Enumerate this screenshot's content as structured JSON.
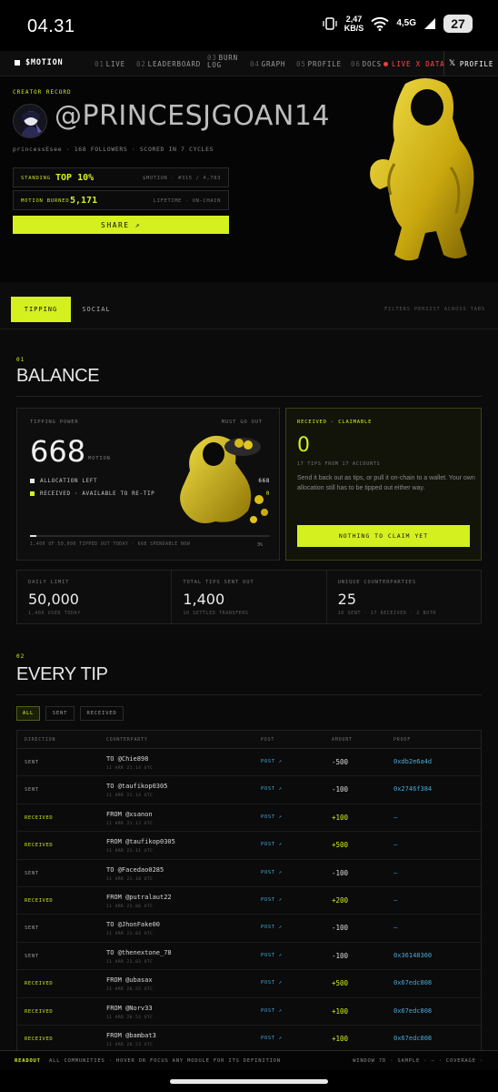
{
  "status_bar": {
    "time": "04.31",
    "net_speed_value": "2,47",
    "net_speed_unit": "KB/S",
    "network": "4,5G",
    "battery": "27"
  },
  "nav": {
    "brand": "$MOTION",
    "items": [
      {
        "num": "01",
        "label": "LIVE"
      },
      {
        "num": "02",
        "label": "LEADERBOARD"
      },
      {
        "num": "03",
        "label": "BURN LOG"
      },
      {
        "num": "04",
        "label": "GRAPH"
      },
      {
        "num": "05",
        "label": "PROFILE"
      },
      {
        "num": "06",
        "label": "DOCS"
      }
    ],
    "live_label": "LIVE X DATA",
    "profile_button": "PROFILE"
  },
  "hero": {
    "record_label": "CREATOR RECORD",
    "handle": "@PRINCESJGOAN14",
    "subline": "princessEsee · 168 FOLLOWERS · SCORED IN 7 CYCLES",
    "standing_label": "STANDING",
    "standing_value": "TOP 10%",
    "standing_right": "$MOTION · #315 / 4,783",
    "burned_label": "MOTION BURNED",
    "burned_value": "5,171",
    "burned_right": "LIFETIME · ON-CHAIN",
    "share_label": "SHARE",
    "share_arrow": "↗"
  },
  "tabs": {
    "items": [
      "TIPPING",
      "SOCIAL"
    ],
    "active": "TIPPING",
    "note": "FILTERS PERSIST ACROSS TABS"
  },
  "balance": {
    "num": "01",
    "title": "BALANCE",
    "power_label": "TIPPING POWER",
    "must_go_out": "MUST GO OUT",
    "power_value": "668",
    "power_unit": "MOTION",
    "legend": [
      {
        "label": "ALLOCATION LEFT",
        "value": "668",
        "color": "#e8e8e8"
      },
      {
        "label": "RECEIVED · AVAILABLE TO RE-TIP",
        "value": "0",
        "color": "#d4f01f"
      }
    ],
    "progress_text": "1,400 OF 50,000 TIPPED OUT TODAY · 668 SPENDABLE NOW",
    "progress_pct_label": "3%",
    "progress_fraction": 0.028,
    "claim_label": "RECEIVED · CLAIMABLE",
    "claim_value": "0",
    "claim_sub": "17 TIPS FROM 17 ACCOUNTS",
    "claim_desc": "Send it back out as tips, or pull it on-chain to a wallet. Your own allocation still has to be tipped out either way.",
    "claim_button": "NOTHING TO CLAIM YET"
  },
  "stats": [
    {
      "label": "DAILY LIMIT",
      "value": "50,000",
      "sub": "1,400 USED TODAY"
    },
    {
      "label": "TOTAL TIPS SENT OUT",
      "value": "1,400",
      "sub": "10 SETTLED TRANSFERS"
    },
    {
      "label": "UNIQUE COUNTERPARTIES",
      "value": "25",
      "sub": "10 SENT · 17 RECEIVED · 2 BOTH"
    }
  ],
  "tips": {
    "num": "02",
    "title": "EVERY TIP",
    "filters": [
      "ALL",
      "SENT",
      "RECEIVED"
    ],
    "active_filter": "ALL",
    "columns": [
      "DIRECTION",
      "COUNTERPARTY",
      "POST",
      "AMOUNT",
      "PROOF"
    ],
    "rows": [
      {
        "direction": "SENT",
        "counterparty": "TO @Chie898",
        "time": "11 ARR 21.14 UTC",
        "post": "POST ↗",
        "amount": "-500",
        "proof": "0xdb2e6a4d"
      },
      {
        "direction": "SENT",
        "counterparty": "TO @taufikop0305",
        "time": "11 ARR 21.14 UTC",
        "post": "POST ↗",
        "amount": "-100",
        "proof": "0x2746f384"
      },
      {
        "direction": "RECEIVED",
        "counterparty": "FROM @xsanon",
        "time": "11 ARR 21.12 UTC",
        "post": "POST ↗",
        "amount": "+100",
        "proof": "—"
      },
      {
        "direction": "RECEIVED",
        "counterparty": "FROM @taufikop0305",
        "time": "11 ARR 21.11 UTC",
        "post": "POST ↗",
        "amount": "+500",
        "proof": "—"
      },
      {
        "direction": "SENT",
        "counterparty": "TO @Facedao0285",
        "time": "11 ARR 21.10 UTC",
        "post": "POST ↗",
        "amount": "-100",
        "proof": "—"
      },
      {
        "direction": "RECEIVED",
        "counterparty": "FROM @putralaut22",
        "time": "11 ARR 21.06 UTC",
        "post": "POST ↗",
        "amount": "+200",
        "proof": "—"
      },
      {
        "direction": "SENT",
        "counterparty": "TO @JhonFake00",
        "time": "11 ARR 21.03 UTC",
        "post": "POST ↗",
        "amount": "-100",
        "proof": "—"
      },
      {
        "direction": "SENT",
        "counterparty": "TO @thenextone_78",
        "time": "11 ARR 21.03 UTC",
        "post": "POST ↗",
        "amount": "-100",
        "proof": "0x36148360"
      },
      {
        "direction": "RECEIVED",
        "counterparty": "FROM @ubasax",
        "time": "11 ARR 20.55 UTC",
        "post": "POST ↗",
        "amount": "+500",
        "proof": "0x67edc808"
      },
      {
        "direction": "RECEIVED",
        "counterparty": "FROM @Norv33",
        "time": "11 ARR 20.53 UTC",
        "post": "POST ↗",
        "amount": "+100",
        "proof": "0x67edc808"
      },
      {
        "direction": "RECEIVED",
        "counterparty": "FROM @bambat3",
        "time": "11 ARR 20.53 UTC",
        "post": "POST ↗",
        "amount": "+100",
        "proof": "0x67edc808"
      }
    ]
  },
  "readout": {
    "label": "READOUT",
    "text": "ALL COMMUNITIES · HOVER OR FOCUS ANY MODULE FOR ITS DEFINITION",
    "right": "WINDOW 7D · SAMPLE · – · COVERAGE ·"
  }
}
